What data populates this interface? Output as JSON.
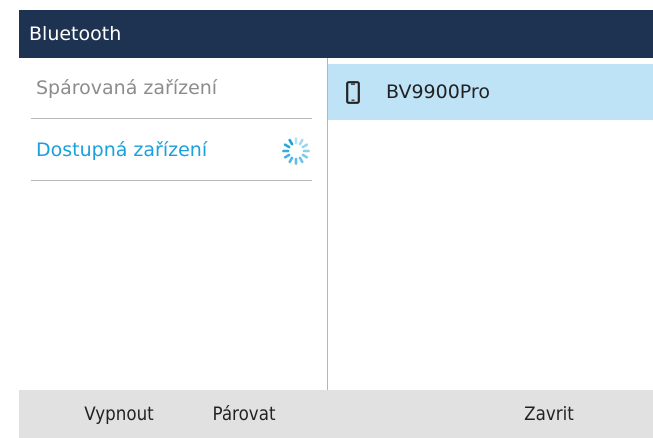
{
  "header": {
    "title": "Bluetooth"
  },
  "sidebar": {
    "items": [
      {
        "label": "Spárovaná zařízení",
        "state": "inactive"
      },
      {
        "label": "Dostupná zařízení",
        "state": "active",
        "loading": true
      }
    ]
  },
  "devices": [
    {
      "name": "BV9900Pro",
      "icon": "mobile-phone-icon",
      "selected": true
    }
  ],
  "softkeys": {
    "key1": "Vypnout",
    "key2": "Párovat",
    "key3": "Zavrit"
  },
  "colors": {
    "header_bg": "#1e3252",
    "accent": "#1aa0dc",
    "selected_row_bg": "#bfe3f6",
    "softkey_bar_bg": "#e1e1e1",
    "inactive_text": "#8c8c8c"
  }
}
